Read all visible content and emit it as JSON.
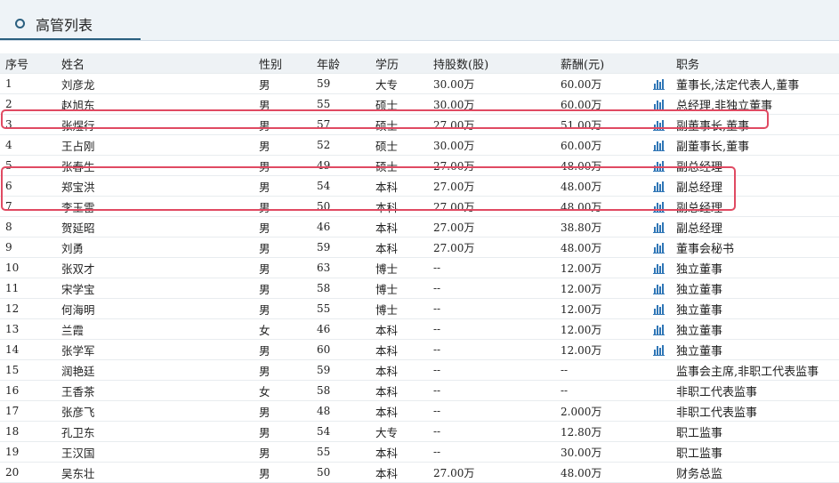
{
  "panel": {
    "title": "高管列表"
  },
  "table": {
    "headers": [
      "序号",
      "姓名",
      "性别",
      "年龄",
      "学历",
      "持股数(股)",
      "薪酬(元)",
      "",
      "职务"
    ],
    "rows": [
      {
        "no": "1",
        "name": "刘彦龙",
        "gender": "男",
        "age": "59",
        "edu": "大专",
        "shares": "30.00万",
        "salary": "60.00万",
        "chart": true,
        "position": "董事长,法定代表人,董事"
      },
      {
        "no": "2",
        "name": "赵旭东",
        "gender": "男",
        "age": "55",
        "edu": "硕士",
        "shares": "30.00万",
        "salary": "60.00万",
        "chart": true,
        "position": "总经理,非独立董事"
      },
      {
        "no": "3",
        "name": "张煜行",
        "gender": "男",
        "age": "57",
        "edu": "硕士",
        "shares": "27.00万",
        "salary": "51.00万",
        "chart": true,
        "position": "副董事长,董事"
      },
      {
        "no": "4",
        "name": "王占刚",
        "gender": "男",
        "age": "52",
        "edu": "硕士",
        "shares": "30.00万",
        "salary": "60.00万",
        "chart": true,
        "position": "副董事长,董事"
      },
      {
        "no": "5",
        "name": "张春生",
        "gender": "男",
        "age": "49",
        "edu": "硕士",
        "shares": "27.00万",
        "salary": "48.00万",
        "chart": true,
        "position": "副总经理"
      },
      {
        "no": "6",
        "name": "郑宝洪",
        "gender": "男",
        "age": "54",
        "edu": "本科",
        "shares": "27.00万",
        "salary": "48.00万",
        "chart": true,
        "position": "副总经理"
      },
      {
        "no": "7",
        "name": "李玉雷",
        "gender": "男",
        "age": "50",
        "edu": "本科",
        "shares": "27.00万",
        "salary": "48.00万",
        "chart": true,
        "position": "副总经理"
      },
      {
        "no": "8",
        "name": "贺延昭",
        "gender": "男",
        "age": "46",
        "edu": "本科",
        "shares": "27.00万",
        "salary": "38.80万",
        "chart": true,
        "position": "副总经理"
      },
      {
        "no": "9",
        "name": "刘勇",
        "gender": "男",
        "age": "59",
        "edu": "本科",
        "shares": "27.00万",
        "salary": "48.00万",
        "chart": true,
        "position": "董事会秘书"
      },
      {
        "no": "10",
        "name": "张双才",
        "gender": "男",
        "age": "63",
        "edu": "博士",
        "shares": "--",
        "salary": "12.00万",
        "chart": true,
        "position": "独立董事"
      },
      {
        "no": "11",
        "name": "宋学宝",
        "gender": "男",
        "age": "58",
        "edu": "博士",
        "shares": "--",
        "salary": "12.00万",
        "chart": true,
        "position": "独立董事"
      },
      {
        "no": "12",
        "name": "何海明",
        "gender": "男",
        "age": "55",
        "edu": "博士",
        "shares": "--",
        "salary": "12.00万",
        "chart": true,
        "position": "独立董事"
      },
      {
        "no": "13",
        "name": "兰霞",
        "gender": "女",
        "age": "46",
        "edu": "本科",
        "shares": "--",
        "salary": "12.00万",
        "chart": true,
        "position": "独立董事"
      },
      {
        "no": "14",
        "name": "张学军",
        "gender": "男",
        "age": "60",
        "edu": "本科",
        "shares": "--",
        "salary": "12.00万",
        "chart": true,
        "position": "独立董事"
      },
      {
        "no": "15",
        "name": "润艳廷",
        "gender": "男",
        "age": "59",
        "edu": "本科",
        "shares": "--",
        "salary": "--",
        "chart": false,
        "position": "监事会主席,非职工代表监事"
      },
      {
        "no": "16",
        "name": "王香茶",
        "gender": "女",
        "age": "58",
        "edu": "本科",
        "shares": "--",
        "salary": "--",
        "chart": false,
        "position": "非职工代表监事"
      },
      {
        "no": "17",
        "name": "张彦飞",
        "gender": "男",
        "age": "48",
        "edu": "本科",
        "shares": "--",
        "salary": "2.000万",
        "chart": false,
        "position": "非职工代表监事"
      },
      {
        "no": "18",
        "name": "孔卫东",
        "gender": "男",
        "age": "54",
        "edu": "大专",
        "shares": "--",
        "salary": "12.80万",
        "chart": false,
        "position": "职工监事"
      },
      {
        "no": "19",
        "name": "王汉国",
        "gender": "男",
        "age": "55",
        "edu": "本科",
        "shares": "--",
        "salary": "30.00万",
        "chart": false,
        "position": "职工监事"
      },
      {
        "no": "20",
        "name": "吴东壮",
        "gender": "男",
        "age": "50",
        "edu": "本科",
        "shares": "27.00万",
        "salary": "48.00万",
        "chart": false,
        "position": "财务总监"
      }
    ]
  },
  "colors": {
    "accent": "#2a5f7f",
    "header_bg": "#eef2f5",
    "highlight": "#e04a62",
    "chart_icon": "#2f76b6"
  }
}
